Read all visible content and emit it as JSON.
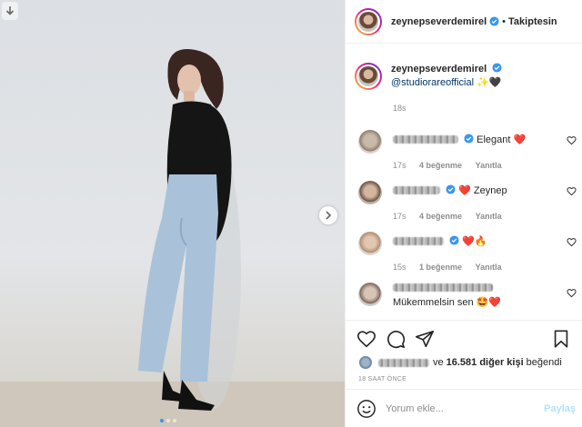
{
  "header": {
    "username": "zeynepseverdemirel",
    "separator": "•",
    "follow_label": "Takiptesin"
  },
  "caption": {
    "username": "zeynepseverdemirel",
    "mention": "@studiorareofficial",
    "emojis": "✨🖤",
    "time": "18s"
  },
  "comments": [
    {
      "text": "Elegant ❤️",
      "time": "17s",
      "likes": "4 beğenme",
      "reply": "Yanıtla"
    },
    {
      "text": "❤️ Zeynep",
      "time": "17s",
      "likes": "4 beğenme",
      "reply": "Yanıtla"
    },
    {
      "text": "❤️🔥",
      "time": "15s",
      "likes": "1 beğenme",
      "reply": "Yanıtla"
    },
    {
      "text": "Mükemmelsin sen 🤩❤️",
      "time": "",
      "likes": "",
      "reply": ""
    }
  ],
  "likes": {
    "connector": "ve",
    "count": "16.581 diğer kişi",
    "suffix": "beğendi"
  },
  "time_ago": "18 SAAT ÖNCE",
  "add_comment": {
    "placeholder": "Yorum ekle...",
    "post_label": "Paylaş"
  },
  "icons": {
    "save": "download-icon",
    "next": "chevron-right-icon",
    "verified": "verified-badge-icon",
    "like": "heart-icon",
    "comment": "comment-icon",
    "share": "send-icon",
    "bookmark": "bookmark-icon",
    "emoji": "smiley-icon"
  },
  "colors": {
    "verified": "#3897f0",
    "link": "#00376b",
    "muted": "#8e8e8e",
    "post_disabled": "#b2dffc",
    "active_dot": "#3897f0"
  },
  "carousel": {
    "current": 1,
    "total": 3
  }
}
